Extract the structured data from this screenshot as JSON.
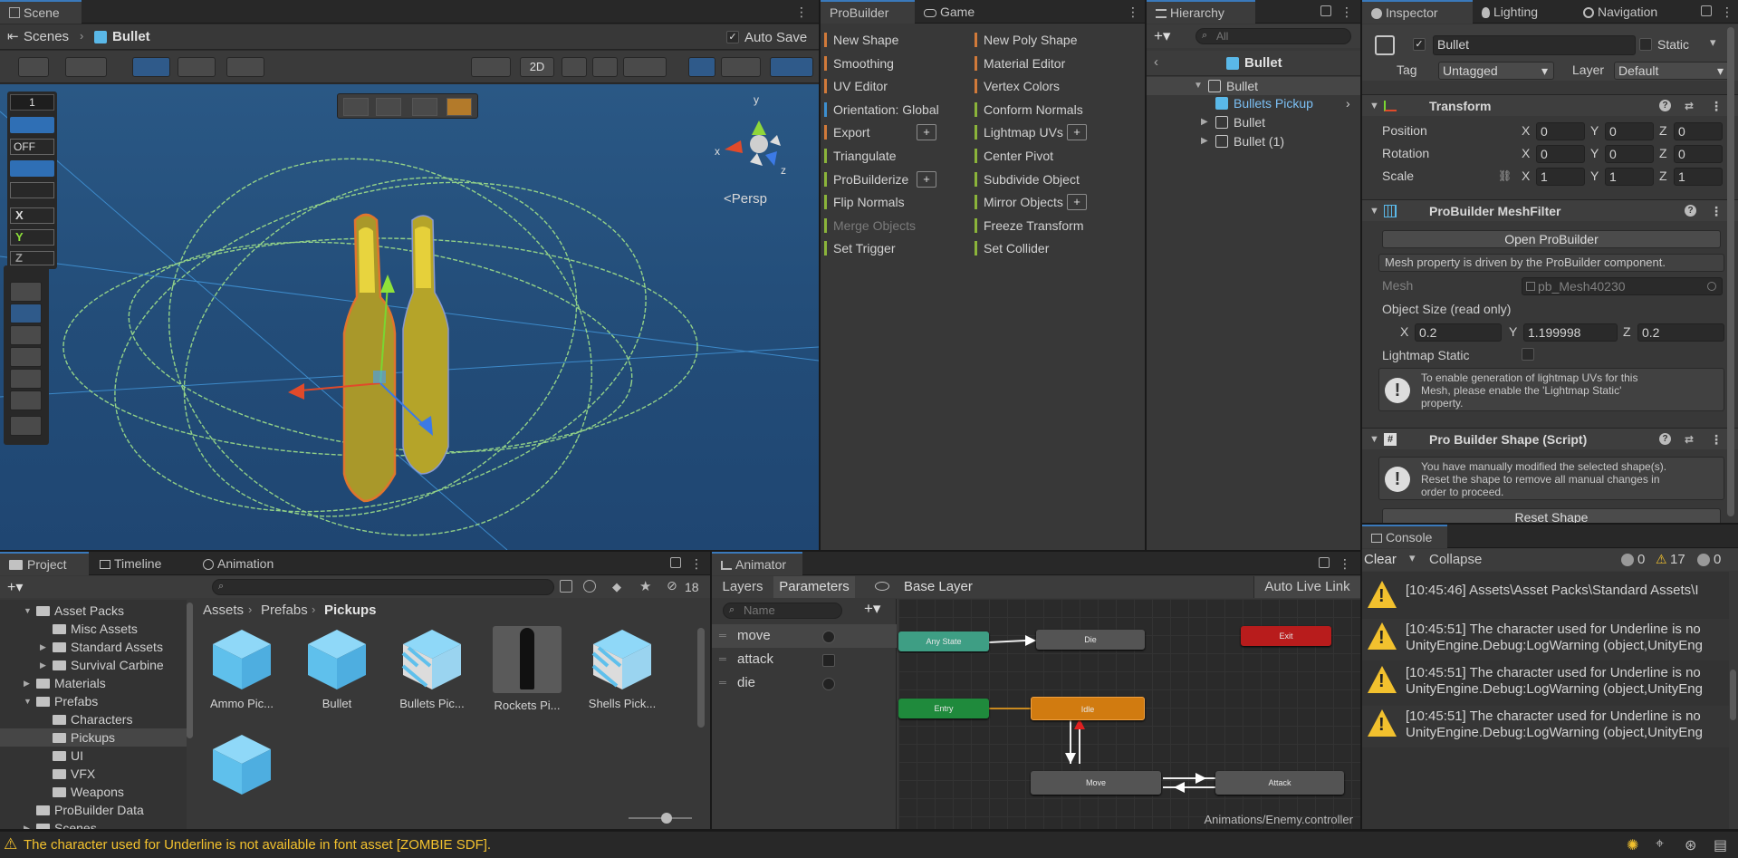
{
  "scene": {
    "tab": "Scene",
    "breadcrumb_root": "Scenes",
    "breadcrumb_current": "Bullet",
    "auto_save": "Auto Save",
    "mode_2d": "2D",
    "persp": "<Persp",
    "gizmo_x": "x",
    "gizmo_y": "y",
    "gizmo_z": "z",
    "overlay_value": "1",
    "overlay_off": "OFF",
    "overlay_x": "X",
    "overlay_y": "Y",
    "overlay_z": "Z"
  },
  "probuilder": {
    "tab": "ProBuilder",
    "game_tab": "Game",
    "left": [
      {
        "label": "New Shape",
        "color": "#d17a3a",
        "plus": false
      },
      {
        "label": "Smoothing",
        "color": "#d17a3a",
        "plus": false
      },
      {
        "label": "UV Editor",
        "color": "#d17a3a",
        "plus": false
      },
      {
        "label": "Orientation: Global",
        "color": "#3d8fcf",
        "plus": false
      },
      {
        "label": "Export",
        "color": "#d17a3a",
        "plus": true
      },
      {
        "label": "Triangulate",
        "color": "#8bb43a",
        "plus": false
      },
      {
        "label": "ProBuilderize",
        "color": "#8bb43a",
        "plus": true
      },
      {
        "label": "Flip Normals",
        "color": "#8bb43a",
        "plus": false
      },
      {
        "label": "Merge Objects",
        "color": "#8bb43a",
        "plus": false,
        "disabled": true
      },
      {
        "label": "Set Trigger",
        "color": "#8bb43a",
        "plus": false
      }
    ],
    "right": [
      {
        "label": "New Poly Shape",
        "color": "#d17a3a",
        "plus": false
      },
      {
        "label": "Material Editor",
        "color": "#d17a3a",
        "plus": false
      },
      {
        "label": "Vertex Colors",
        "color": "#d17a3a",
        "plus": false
      },
      {
        "label": "Conform Normals",
        "color": "#8bb43a",
        "plus": false
      },
      {
        "label": "Lightmap UVs",
        "color": "#8bb43a",
        "plus": true
      },
      {
        "label": "Center Pivot",
        "color": "#8bb43a",
        "plus": false
      },
      {
        "label": "Subdivide Object",
        "color": "#8bb43a",
        "plus": false
      },
      {
        "label": "Mirror Objects",
        "color": "#8bb43a",
        "plus": true
      },
      {
        "label": "Freeze Transform",
        "color": "#8bb43a",
        "plus": false
      },
      {
        "label": "Set Collider",
        "color": "#8bb43a",
        "plus": false
      }
    ],
    "plus_glyph": "+"
  },
  "hierarchy": {
    "tab": "Hierarchy",
    "search_placeholder": "All",
    "root": "Bullet",
    "items": [
      {
        "label": "Bullet",
        "indent": 0
      },
      {
        "label": "Bullets Pickup",
        "indent": 1
      },
      {
        "label": "Bullet",
        "indent": 1
      },
      {
        "label": "Bullet (1)",
        "indent": 1
      }
    ]
  },
  "inspector": {
    "tabs": [
      "Inspector",
      "Lighting",
      "Navigation"
    ],
    "object_name": "Bullet",
    "static_label": "Static",
    "tag_label": "Tag",
    "tag_value": "Untagged",
    "layer_label": "Layer",
    "layer_value": "Default",
    "transform": {
      "title": "Transform",
      "rows": [
        {
          "label": "Position",
          "x": "0",
          "y": "0",
          "z": "0"
        },
        {
          "label": "Rotation",
          "x": "0",
          "y": "0",
          "z": "0"
        },
        {
          "label": "Scale",
          "x": "1",
          "y": "1",
          "z": "1"
        }
      ],
      "x": "X",
      "y": "Y",
      "z": "Z"
    },
    "meshfilter": {
      "title": "ProBuilder MeshFilter",
      "open_button": "Open ProBuilder",
      "driven_note": "Mesh property is driven by the ProBuilder component.",
      "mesh_label": "Mesh",
      "mesh_value": "pb_Mesh40230",
      "size_label": "Object Size (read only)",
      "size_x": "0.2",
      "size_y": "1.199998",
      "size_z": "0.2",
      "lightmap_label": "Lightmap Static",
      "lightmap_info": [
        "To enable generation of lightmap UVs for this",
        "Mesh, please enable the 'Lightmap Static'",
        "property."
      ]
    },
    "shape": {
      "title": "Pro Builder Shape (Script)",
      "info": [
        "You have manually modified the selected shape(s).",
        "Reset the shape to remove all manual changes in",
        "order to proceed."
      ],
      "reset_button": "Reset Shape"
    }
  },
  "project": {
    "tabs": [
      "Project",
      "Timeline",
      "Animation"
    ],
    "hidden_count": "18",
    "breadcrumb": [
      "Assets",
      "Prefabs",
      "Pickups"
    ],
    "tree": [
      {
        "label": "Asset Packs",
        "indent": 1,
        "arrow": "open"
      },
      {
        "label": "Misc Assets",
        "indent": 2,
        "arrow": "none"
      },
      {
        "label": "Standard Assets",
        "indent": 2,
        "arrow": "closed"
      },
      {
        "label": "Survival Carbine",
        "indent": 2,
        "arrow": "closed"
      },
      {
        "label": "Materials",
        "indent": 1,
        "arrow": "closed"
      },
      {
        "label": "Prefabs",
        "indent": 1,
        "arrow": "open"
      },
      {
        "label": "Characters",
        "indent": 2,
        "arrow": "none"
      },
      {
        "label": "Pickups",
        "indent": 2,
        "arrow": "none",
        "selected": true
      },
      {
        "label": "UI",
        "indent": 2,
        "arrow": "none"
      },
      {
        "label": "VFX",
        "indent": 2,
        "arrow": "none"
      },
      {
        "label": "Weapons",
        "indent": 2,
        "arrow": "none"
      },
      {
        "label": "ProBuilder Data",
        "indent": 1,
        "arrow": "none"
      },
      {
        "label": "Scenes",
        "indent": 1,
        "arrow": "closed"
      }
    ],
    "assets": [
      {
        "label": "Ammo Pic...",
        "kind": "cube"
      },
      {
        "label": "Bullet",
        "kind": "cube"
      },
      {
        "label": "Bullets Pic...",
        "kind": "striped"
      },
      {
        "label": "Rockets Pi...",
        "kind": "rocket"
      },
      {
        "label": "Shells Pick...",
        "kind": "striped"
      },
      {
        "label": "",
        "kind": "cube"
      }
    ]
  },
  "animator": {
    "tab": "Animator",
    "layers_tab": "Layers",
    "params_tab": "Parameters",
    "base_layer": "Base Layer",
    "auto_live": "Auto Live Link",
    "name_placeholder": "Name",
    "params": [
      {
        "label": "move",
        "type": "trigger"
      },
      {
        "label": "attack",
        "type": "bool"
      },
      {
        "label": "die",
        "type": "trigger"
      }
    ],
    "nodes": {
      "any": "Any State",
      "die": "Die",
      "exit": "Exit",
      "entry": "Entry",
      "idle": "Idle",
      "move": "Move",
      "attack": "Attack"
    },
    "footer": "Animations/Enemy.controller"
  },
  "console": {
    "tab": "Console",
    "clear": "Clear",
    "collapse": "Collapse",
    "count_info": "0",
    "count_warn": "17",
    "count_error": "0",
    "entries": [
      {
        "line1": "[10:45:46] Assets\\Asset Packs\\Standard Assets\\I",
        "line2": ""
      },
      {
        "line1": "[10:45:51] The character used for Underline is no",
        "line2": "UnityEngine.Debug:LogWarning (object,UnityEng"
      },
      {
        "line1": "[10:45:51] The character used for Underline is no",
        "line2": "UnityEngine.Debug:LogWarning (object,UnityEng"
      },
      {
        "line1": "[10:45:51] The character used for Underline is no",
        "line2": "UnityEngine.Debug:LogWarning (object,UnityEng"
      }
    ]
  },
  "statusbar": {
    "message": "The character used for Underline is not available in font asset [ZOMBIE SDF]."
  }
}
